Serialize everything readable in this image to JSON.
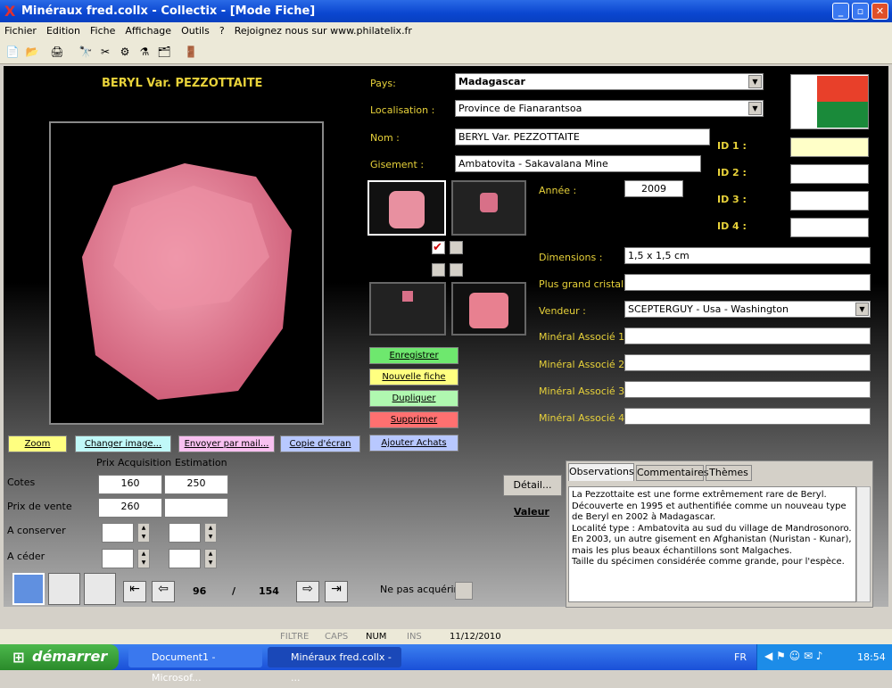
{
  "window": {
    "title": "Minéraux fred.collx - Collectix - [Mode Fiche]"
  },
  "menu": [
    "Fichier",
    "Edition",
    "Fiche",
    "Affichage",
    "Outils",
    "?",
    "Rejoignez nous sur www.philatelix.fr"
  ],
  "toolbar_icons": [
    "new-icon",
    "open-icon",
    "print-icon",
    "binoculars-icon",
    "tools-icon",
    "settings-icon",
    "filter-icon",
    "export-icon",
    "exit-icon"
  ],
  "specimen": {
    "title": "BERYL Var. PEZZOTTAITE"
  },
  "labels": {
    "pays": "Pays:",
    "localisation": "Localisation :",
    "nom": "Nom :",
    "gisement": "Gisement :",
    "annee": "Année :",
    "dimensions": "Dimensions :",
    "cristal": "Plus grand cristal :",
    "vendeur": "Vendeur :",
    "mineral1": "Minéral Associé 1 :",
    "mineral2": "Minéral Associé 2 :",
    "mineral3": "Minéral Associé 3 :",
    "mineral4": "Minéral Associé 4 :",
    "id1": "ID 1 :",
    "id2": "ID 2 :",
    "id3": "ID 3 :",
    "id4": "ID 4 :"
  },
  "values": {
    "pays": "Madagascar",
    "localisation": "Province de Fianarantsoa",
    "nom": "BERYL Var. PEZZOTTAITE",
    "gisement": "Ambatovita - Sakavalana Mine",
    "annee": "2009",
    "dimensions": "1,5 x 1,5 cm",
    "cristal": "",
    "vendeur": "SCEPTERGUY - Usa - Washington",
    "mineral1": "",
    "mineral2": "",
    "mineral3": "",
    "mineral4": "",
    "id1": "",
    "id2": "",
    "id3": "",
    "id4": ""
  },
  "actions": {
    "enregistrer": "Enregistrer",
    "nouvelle": "Nouvelle fiche",
    "dupliquer": "Dupliquer",
    "supprimer": "Supprimer",
    "achats": "Ajouter Achats",
    "zoom": "Zoom",
    "changer": "Changer image...",
    "envoyer": "Envoyer par mail...",
    "copie": "Copie d'écran",
    "detail": "Détail...",
    "valeur": "Valeur"
  },
  "prices": {
    "col_acq": "Prix Acquisition",
    "col_est": "Estimation",
    "cotes_label": "Cotes",
    "cotes_acq": "160",
    "cotes_est": "250",
    "vente_label": "Prix de vente",
    "vente_acq": "260",
    "vente_est": "",
    "conserver_label": "A conserver",
    "ceder_label": "A céder"
  },
  "nav": {
    "current": "96",
    "sep": "/",
    "total": "154",
    "ne_pas": "Ne pas acquérir"
  },
  "tabs": [
    "Observations",
    "Commentaires",
    "Thèmes"
  ],
  "observations": "La Pezzottaite est une forme extrêmement rare de Beryl.\nDécouverte en 1995 et authentifiée comme un nouveau type de Beryl en 2002 à Madagascar.\nLocalité type : Ambatovita au sud du village de Mandrosonoro.\nEn 2003, un autre gisement en Afghanistan (Nuristan - Kunar), mais les plus beaux échantillons sont Malgaches.\nTaille du spécimen considérée comme grande, pour l'espèce.",
  "status": {
    "filtre": "FILTRE",
    "caps": "CAPS",
    "num": "NUM",
    "ins": "INS",
    "date": "11/12/2010"
  },
  "taskbar": {
    "start": "démarrer",
    "task1": "Document1 - Microsof...",
    "task2": "Minéraux fred.collx - ...",
    "lang": "FR",
    "time": "18:54"
  },
  "colors": {
    "label": "#e8d23a",
    "flag_green": "#1a8a3a",
    "flag_red": "#e8402a",
    "btn_green": "#6ee86e",
    "btn_yellow": "#ffff80",
    "btn_red": "#ff7070",
    "btn_blue": "#b8c8ff"
  }
}
